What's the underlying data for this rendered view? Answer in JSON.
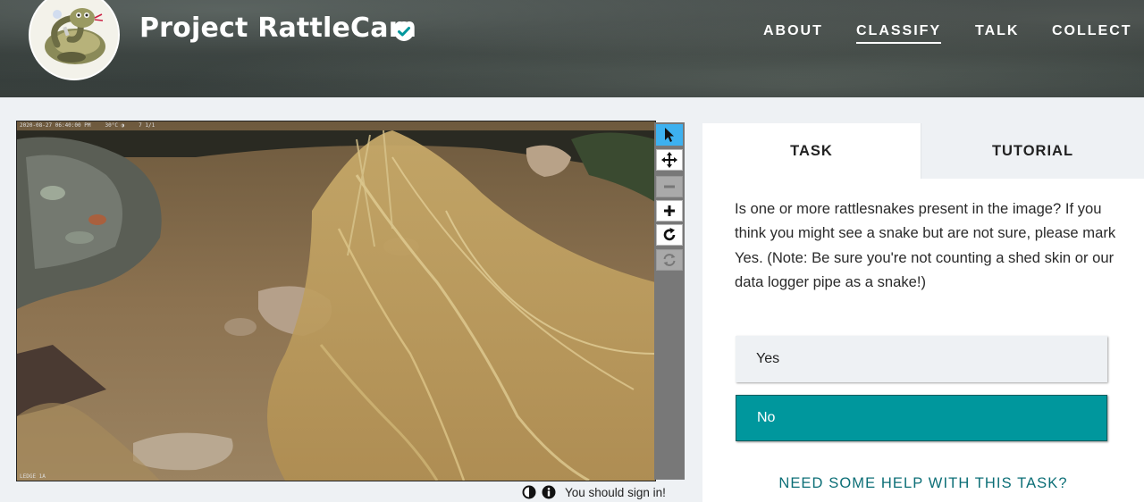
{
  "header": {
    "project_title": "Project RattleCam",
    "avatar_icon": "rattlesnake-cartoon-avatar",
    "verified_icon": "verified-check-icon",
    "nav": [
      {
        "label": "ABOUT",
        "active": false
      },
      {
        "label": "CLASSIFY",
        "active": true
      },
      {
        "label": "TALK",
        "active": false
      },
      {
        "label": "COLLECT",
        "active": false
      }
    ]
  },
  "viewer": {
    "image_meta_top": [
      "2020-08-27 06:40:00 PM",
      "30°C ◑",
      "7 1/1"
    ],
    "image_meta_bottom": "LEDGE 1A",
    "toolbar": [
      {
        "icon": "pointer-arrow-icon",
        "state": "selected"
      },
      {
        "icon": "move-arrows-icon",
        "state": "enabled"
      },
      {
        "icon": "zoom-out-icon",
        "state": "disabled"
      },
      {
        "icon": "zoom-in-icon",
        "state": "enabled"
      },
      {
        "icon": "rotate-icon",
        "state": "enabled"
      },
      {
        "icon": "reset-icon",
        "state": "disabled"
      }
    ],
    "footer": {
      "invert_icon": "contrast-icon",
      "info_icon": "info-icon",
      "sign_in_text": "You should sign in!"
    }
  },
  "panel": {
    "tabs": [
      {
        "label": "TASK",
        "active": true
      },
      {
        "label": "TUTORIAL",
        "active": false
      }
    ],
    "question": "Is one or more rattlesnakes present in the image? If you think you might see a snake but are not sure, please mark Yes. (Note: Be sure you're not counting a shed skin or our data logger pipe as a snake!)",
    "answers": [
      {
        "label": "Yes",
        "selected": false
      },
      {
        "label": "No",
        "selected": true
      }
    ],
    "help_link": "NEED SOME HELP WITH THIS TASK?"
  },
  "colors": {
    "accent_teal": "#00979d",
    "help_link": "#0b6e76",
    "page_bg": "#eef1f4",
    "tool_selected": "#3db1f0"
  }
}
